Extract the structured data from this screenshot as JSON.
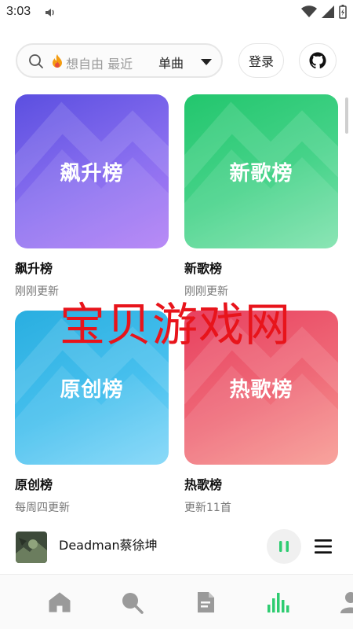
{
  "status_bar": {
    "time": "3:03"
  },
  "search": {
    "placeholder": "想自由 最近",
    "type_label": "单曲"
  },
  "header": {
    "login_label": "登录"
  },
  "charts": [
    {
      "cover_text": "飙升榜",
      "title": "飙升榜",
      "subtitle": "刚刚更新",
      "color": "#6c5ce7"
    },
    {
      "cover_text": "新歌榜",
      "title": "新歌榜",
      "subtitle": "刚刚更新",
      "color": "#2ecc71"
    },
    {
      "cover_text": "原创榜",
      "title": "原创榜",
      "subtitle": "每周四更新",
      "color": "#3bb8ea"
    },
    {
      "cover_text": "热歌榜",
      "title": "热歌榜",
      "subtitle": "更新11首",
      "color": "#ec5266"
    }
  ],
  "watermark": "宝贝游戏网",
  "player": {
    "song": "Deadman蔡徐坤"
  },
  "colors": {
    "accent": "#2ecc71"
  },
  "nav": [
    {
      "icon": "home-icon"
    },
    {
      "icon": "search-icon"
    },
    {
      "icon": "document-icon"
    },
    {
      "icon": "chart-bars-icon",
      "active": true
    },
    {
      "icon": "user-icon"
    }
  ]
}
